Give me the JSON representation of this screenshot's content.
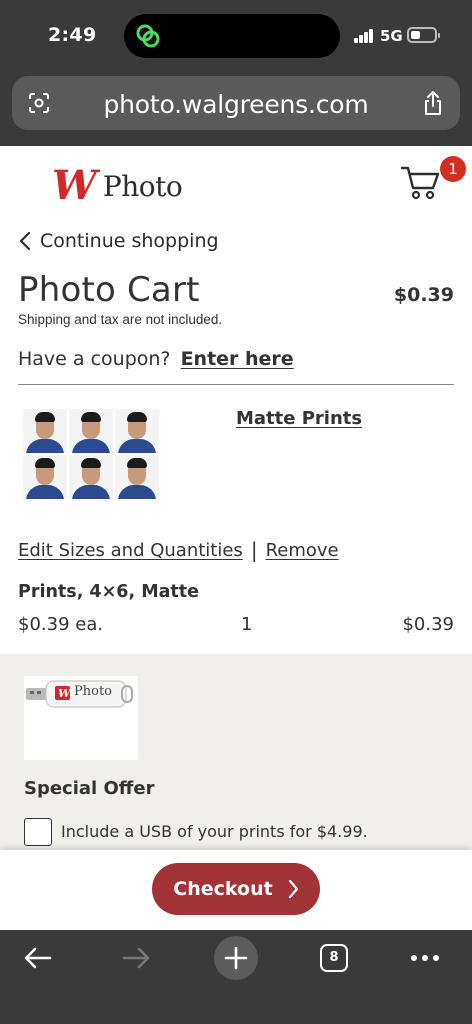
{
  "status": {
    "time": "2:49",
    "network": "5G",
    "battery_level": 0.25
  },
  "browser": {
    "url": "photo.walgreens.com",
    "tab_count": "8"
  },
  "header": {
    "logo_mark": "W",
    "logo_text": "Photo",
    "cart_count": "1"
  },
  "nav": {
    "continue_label": "Continue shopping"
  },
  "cart": {
    "title": "Photo Cart",
    "total": "$0.39",
    "shipping_note": "Shipping and tax are not included.",
    "coupon_prompt": "Have a coupon?",
    "coupon_link": "Enter here"
  },
  "item": {
    "product_name": "Matte Prints",
    "edit_label": "Edit Sizes and Quantities",
    "separator": "|",
    "remove_label": "Remove",
    "description": "Prints, 4×6, Matte",
    "unit_price": "$0.39 ea.",
    "quantity": "1",
    "line_total": "$0.39"
  },
  "offer": {
    "usb_logo_text": "Photo",
    "title": "Special Offer",
    "label": "Include a USB of your prints for $4.99.",
    "checked": false
  },
  "checkout": {
    "label": "Checkout"
  },
  "colors": {
    "brand_red": "#cf2a27",
    "checkout_bg": "#a23437",
    "badge_red": "#d22e24",
    "offer_bg": "#f1efec"
  }
}
